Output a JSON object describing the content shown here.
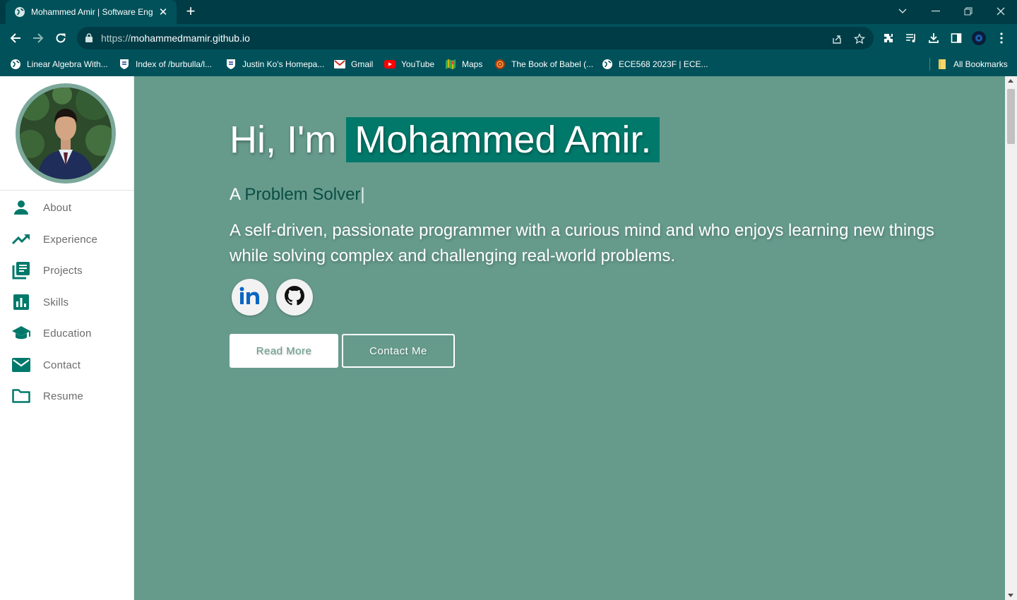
{
  "browser": {
    "tab_title": "Mohammed Amir | Software Engineer",
    "url_scheme": "https://",
    "url_host": "mohammedmamir.github.io",
    "bookmarks": [
      {
        "label": "Linear Algebra With...",
        "icon": "globe-icon"
      },
      {
        "label": "Index of /burbulla/l...",
        "icon": "crest-icon"
      },
      {
        "label": "Justin Ko's Homepa...",
        "icon": "crest-icon"
      },
      {
        "label": "Gmail",
        "icon": "gmail-icon"
      },
      {
        "label": "YouTube",
        "icon": "youtube-icon"
      },
      {
        "label": "Maps",
        "icon": "maps-icon"
      },
      {
        "label": "The Book of Babel (...",
        "icon": "babel-icon"
      },
      {
        "label": "ECE568 2023F | ECE...",
        "icon": "globe-icon"
      }
    ],
    "all_bookmarks": "All Bookmarks"
  },
  "sidebar": {
    "items": [
      {
        "label": "About",
        "icon": "person-icon"
      },
      {
        "label": "Experience",
        "icon": "trending-up-icon"
      },
      {
        "label": "Projects",
        "icon": "library-books-icon"
      },
      {
        "label": "Skills",
        "icon": "bar-chart-icon"
      },
      {
        "label": "Education",
        "icon": "graduation-cap-icon"
      },
      {
        "label": "Contact",
        "icon": "mail-icon"
      },
      {
        "label": "Resume",
        "icon": "folder-icon"
      }
    ]
  },
  "hero": {
    "greeting": "Hi, I'm",
    "name": "Mohammed Amir.",
    "tagline_prefix": "A",
    "tagline_role": "Problem Solver",
    "caret": "|",
    "bio": "A self-driven, passionate programmer with a curious mind and who enjoys learning new things while solving complex and challenging real-world problems.",
    "read_more": "Read More",
    "contact_me": "Contact Me"
  },
  "colors": {
    "accent": "#00796b",
    "page_bg": "#669b8c",
    "chrome_dark": "#003c46",
    "chrome": "#00515a"
  }
}
